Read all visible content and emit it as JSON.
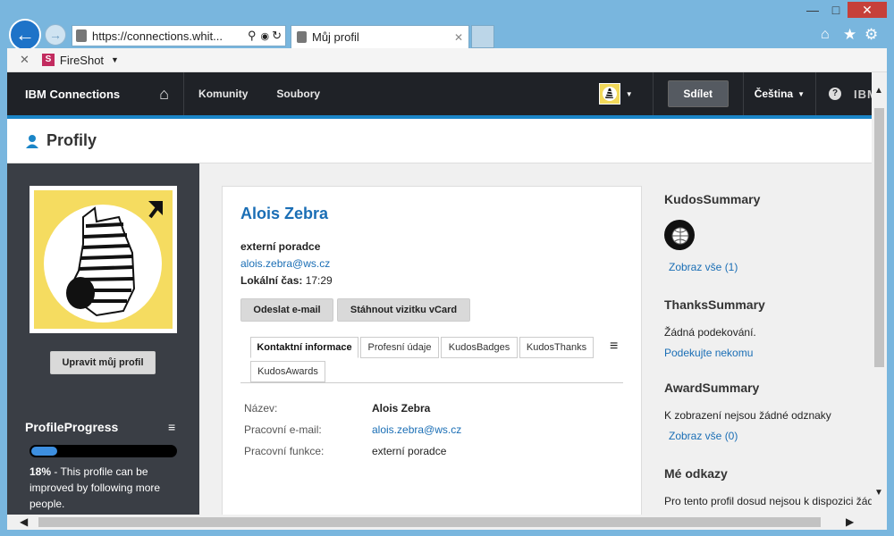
{
  "browser": {
    "url": "https://connections.whit...",
    "tab_title": "Můj profil",
    "extension_label": "FireShot"
  },
  "topnav": {
    "brand": "IBM Connections",
    "items": [
      "Komunity",
      "Soubory"
    ],
    "share_label": "Sdílet",
    "language": "Čeština"
  },
  "header": {
    "title": "Profily"
  },
  "left": {
    "edit_button": "Upravit můj profil",
    "progress_title": "ProfileProgress",
    "progress_value": 0.18,
    "progress_percent": "18%",
    "progress_text": " - This profile can be improved by following more people."
  },
  "profile": {
    "name": "Alois Zebra",
    "role": "externí poradce",
    "email": "alois.zebra@ws.cz",
    "local_time_label": "Lokální čas:",
    "local_time": "17:29",
    "send_email": "Odeslat e-mail",
    "download_vcard": "Stáhnout vizitku vCard",
    "tabs": [
      "Kontaktní informace",
      "Profesní údaje",
      "KudosBadges",
      "KudosThanks",
      "KudosAwards"
    ],
    "fields": [
      {
        "label": "Název:",
        "value": "Alois Zebra"
      },
      {
        "label": "Pracovní e-mail:",
        "value": "alois.zebra@ws.cz"
      },
      {
        "label": "Pracovní funkce:",
        "value": "externí poradce"
      }
    ]
  },
  "right": {
    "kudos_title": "KudosSummary",
    "kudos_link": "Zobraz vše (1)",
    "thanks_title": "ThanksSummary",
    "thanks_text": "Žádná podekování.",
    "thanks_link": "Podekujte nekomu",
    "award_title": "AwardSummary",
    "award_text": "K zobrazení nejsou žádné odznaky",
    "award_link": "Zobraz vše (0)",
    "links_title": "Mé odkazy",
    "links_text": "Pro tento profil dosud nejsou k dispozici žádné"
  },
  "colors": {
    "accent": "#1a85c7",
    "link": "#1a6eb5",
    "nav_bg": "#1f2227",
    "sidebar_bg": "#3a3e45",
    "progress": "#3d8fe0"
  }
}
